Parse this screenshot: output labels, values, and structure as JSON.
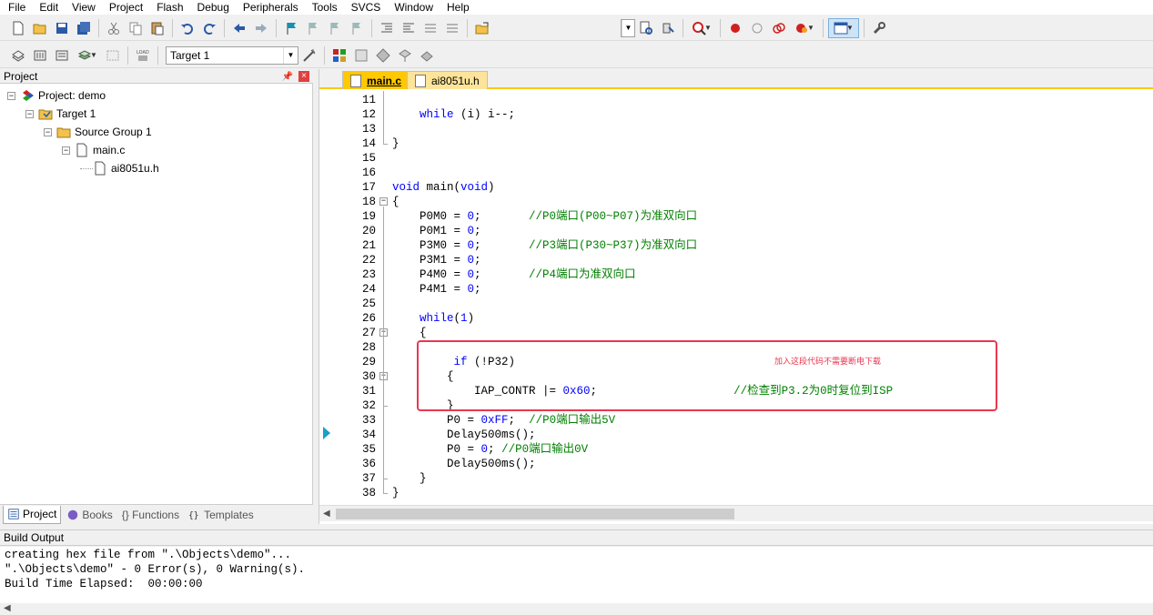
{
  "menu": [
    "File",
    "Edit",
    "View",
    "Project",
    "Flash",
    "Debug",
    "Peripherals",
    "Tools",
    "SVCS",
    "Window",
    "Help"
  ],
  "toolbar2": {
    "target_combo": "Target 1"
  },
  "project_panel": {
    "title": "Project",
    "tree": {
      "project": "Project: demo",
      "target": "Target 1",
      "group": "Source Group 1",
      "file1": "main.c",
      "file2": "ai8051u.h"
    },
    "tabs": [
      "Project",
      "Books",
      "{} Functions",
      "Templates"
    ]
  },
  "editor": {
    "tabs": [
      "main.c",
      "ai8051u.h"
    ],
    "lines": [
      {
        "n": "11",
        "t": ""
      },
      {
        "n": "12",
        "t": "    while (i) i--;"
      },
      {
        "n": "13",
        "t": ""
      },
      {
        "n": "14",
        "t": "}"
      },
      {
        "n": "15",
        "t": ""
      },
      {
        "n": "16",
        "t": ""
      },
      {
        "n": "17",
        "t": "void main(void)"
      },
      {
        "n": "18",
        "t": "{"
      },
      {
        "n": "19",
        "t": "    P0M0 = 0;       //P0端口(P00~P07)为准双向口"
      },
      {
        "n": "20",
        "t": "    P0M1 = 0;"
      },
      {
        "n": "21",
        "t": "    P3M0 = 0;       //P3端口(P30~P37)为准双向口"
      },
      {
        "n": "22",
        "t": "    P3M1 = 0;"
      },
      {
        "n": "23",
        "t": "    P4M0 = 0;       //P4端口为准双向口"
      },
      {
        "n": "24",
        "t": "    P4M1 = 0;"
      },
      {
        "n": "25",
        "t": ""
      },
      {
        "n": "26",
        "t": "    while(1)"
      },
      {
        "n": "27",
        "t": "    {"
      },
      {
        "n": "28",
        "t": ""
      },
      {
        "n": "29",
        "t": "         if (!P32)"
      },
      {
        "n": "30",
        "t": "        {"
      },
      {
        "n": "31",
        "t": "            IAP_CONTR |= 0x60;                    //检查到P3.2为0时复位到ISP"
      },
      {
        "n": "32",
        "t": "        }"
      },
      {
        "n": "33",
        "t": "        P0 = 0xFF;  //P0端口输出5V"
      },
      {
        "n": "34",
        "t": "        Delay500ms();"
      },
      {
        "n": "35",
        "t": "        P0 = 0; //P0端口输出0V"
      },
      {
        "n": "36",
        "t": "        Delay500ms();"
      },
      {
        "n": "37",
        "t": "    }"
      },
      {
        "n": "38",
        "t": "}"
      }
    ],
    "annotation": "加入这段代码不需要断电下载"
  },
  "build": {
    "title": "Build Output",
    "lines": [
      "creating hex file from \".\\Objects\\demo\"...",
      "\".\\Objects\\demo\" - 0 Error(s), 0 Warning(s).",
      "Build Time Elapsed:  00:00:00"
    ]
  },
  "colors": {
    "keyword": "#0000ff",
    "comment": "#008000",
    "tab_active": "#ffc800",
    "annotation_red": "#e8384f"
  }
}
